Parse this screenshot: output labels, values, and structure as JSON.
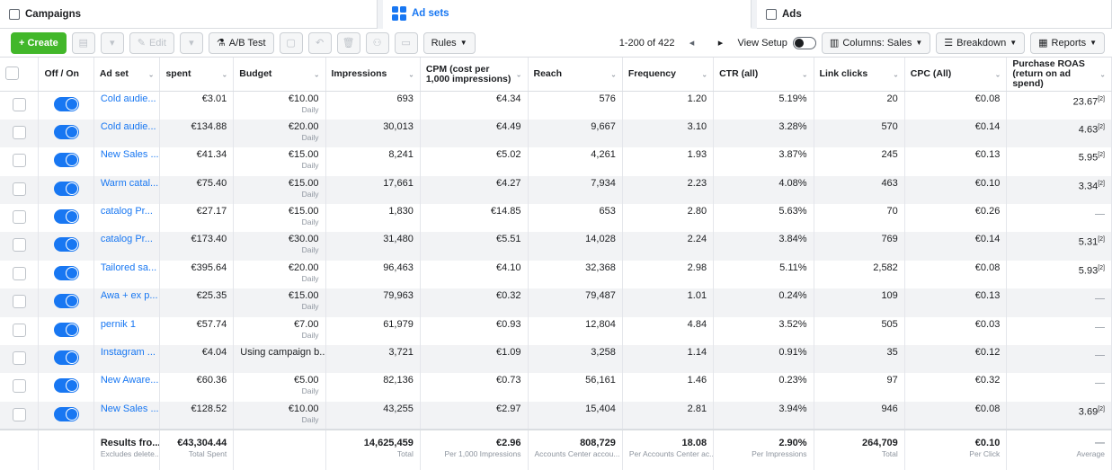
{
  "tabs": {
    "campaigns": "Campaigns",
    "adsets": "Ad sets",
    "ads": "Ads"
  },
  "toolbar": {
    "create": "+ Create",
    "edit": "Edit",
    "ab_test": "A/B Test",
    "rules": "Rules",
    "pagination": "1-200 of 422",
    "view_setup": "View Setup",
    "columns": "Columns: Sales",
    "breakdown": "Breakdown",
    "reports": "Reports"
  },
  "columns": {
    "onoff": "Off / On",
    "adset": "Ad set",
    "spent": "spent",
    "budget": "Budget",
    "impressions": "Impressions",
    "cpm": "CPM (cost per 1,000 impressions)",
    "reach": "Reach",
    "frequency": "Frequency",
    "ctr": "CTR (all)",
    "link_clicks": "Link clicks",
    "cpc": "CPC (All)",
    "roas": "Purchase ROAS (return on ad spend)"
  },
  "rows": [
    {
      "name": "Cold audie...",
      "spent": "€3.01",
      "budget": "€10.00",
      "budget_sub": "Daily",
      "impressions": "693",
      "cpm": "€4.34",
      "reach": "576",
      "frequency": "1.20",
      "ctr": "5.19%",
      "clicks": "20",
      "cpc": "€0.08",
      "roas": "23.67",
      "roas_sup": "[2]"
    },
    {
      "name": "Cold audie...",
      "spent": "€134.88",
      "budget": "€20.00",
      "budget_sub": "Daily",
      "impressions": "30,013",
      "cpm": "€4.49",
      "reach": "9,667",
      "frequency": "3.10",
      "ctr": "3.28%",
      "clicks": "570",
      "cpc": "€0.14",
      "roas": "4.63",
      "roas_sup": "[2]"
    },
    {
      "name": "New Sales ...",
      "spent": "€41.34",
      "budget": "€15.00",
      "budget_sub": "Daily",
      "impressions": "8,241",
      "cpm": "€5.02",
      "reach": "4,261",
      "frequency": "1.93",
      "ctr": "3.87%",
      "clicks": "245",
      "cpc": "€0.13",
      "roas": "5.95",
      "roas_sup": "[2]"
    },
    {
      "name": "Warm catal...",
      "spent": "€75.40",
      "budget": "€15.00",
      "budget_sub": "Daily",
      "impressions": "17,661",
      "cpm": "€4.27",
      "reach": "7,934",
      "frequency": "2.23",
      "ctr": "4.08%",
      "clicks": "463",
      "cpc": "€0.10",
      "roas": "3.34",
      "roas_sup": "[2]"
    },
    {
      "name": "catalog Pr...",
      "spent": "€27.17",
      "budget": "€15.00",
      "budget_sub": "Daily",
      "impressions": "1,830",
      "cpm": "€14.85",
      "reach": "653",
      "frequency": "2.80",
      "ctr": "5.63%",
      "clicks": "70",
      "cpc": "€0.26",
      "roas": "—",
      "roas_sup": ""
    },
    {
      "name": "catalog Pr...",
      "spent": "€173.40",
      "budget": "€30.00",
      "budget_sub": "Daily",
      "impressions": "31,480",
      "cpm": "€5.51",
      "reach": "14,028",
      "frequency": "2.24",
      "ctr": "3.84%",
      "clicks": "769",
      "cpc": "€0.14",
      "roas": "5.31",
      "roas_sup": "[2]"
    },
    {
      "name": "Tailored sa...",
      "spent": "€395.64",
      "budget": "€20.00",
      "budget_sub": "Daily",
      "impressions": "96,463",
      "cpm": "€4.10",
      "reach": "32,368",
      "frequency": "2.98",
      "ctr": "5.11%",
      "clicks": "2,582",
      "cpc": "€0.08",
      "roas": "5.93",
      "roas_sup": "[2]"
    },
    {
      "name": "Awa + ex p...",
      "spent": "€25.35",
      "budget": "€15.00",
      "budget_sub": "Daily",
      "impressions": "79,963",
      "cpm": "€0.32",
      "reach": "79,487",
      "frequency": "1.01",
      "ctr": "0.24%",
      "clicks": "109",
      "cpc": "€0.13",
      "roas": "—",
      "roas_sup": ""
    },
    {
      "name": "pernik 1",
      "spent": "€57.74",
      "budget": "€7.00",
      "budget_sub": "Daily",
      "impressions": "61,979",
      "cpm": "€0.93",
      "reach": "12,804",
      "frequency": "4.84",
      "ctr": "3.52%",
      "clicks": "505",
      "cpc": "€0.03",
      "roas": "—",
      "roas_sup": ""
    },
    {
      "name": "Instagram ...",
      "spent": "€4.04",
      "budget": "Using campaign b...",
      "budget_sub": "",
      "impressions": "3,721",
      "cpm": "€1.09",
      "reach": "3,258",
      "frequency": "1.14",
      "ctr": "0.91%",
      "clicks": "35",
      "cpc": "€0.12",
      "roas": "—",
      "roas_sup": ""
    },
    {
      "name": "New Aware...",
      "spent": "€60.36",
      "budget": "€5.00",
      "budget_sub": "Daily",
      "impressions": "82,136",
      "cpm": "€0.73",
      "reach": "56,161",
      "frequency": "1.46",
      "ctr": "0.23%",
      "clicks": "97",
      "cpc": "€0.32",
      "roas": "—",
      "roas_sup": ""
    },
    {
      "name": "New Sales ...",
      "spent": "€128.52",
      "budget": "€10.00",
      "budget_sub": "Daily",
      "impressions": "43,255",
      "cpm": "€2.97",
      "reach": "15,404",
      "frequency": "2.81",
      "ctr": "3.94%",
      "clicks": "946",
      "cpc": "€0.08",
      "roas": "3.69",
      "roas_sup": "[2]"
    }
  ],
  "totals": {
    "name": "Results fro...",
    "name_sub": "Excludes delete...",
    "spent": "€43,304.44",
    "spent_sub": "Total Spent",
    "impressions": "14,625,459",
    "impressions_sub": "Total",
    "cpm": "€2.96",
    "cpm_sub": "Per 1,000 Impressions",
    "reach": "808,729",
    "reach_sub": "Accounts Center accou...",
    "frequency": "18.08",
    "frequency_sub": "Per Accounts Center ac...",
    "ctr": "2.90%",
    "ctr_sub": "Per Impressions",
    "clicks": "264,709",
    "clicks_sub": "Total",
    "cpc": "€0.10",
    "cpc_sub": "Per Click",
    "roas": "—",
    "roas_sub": "Average"
  }
}
